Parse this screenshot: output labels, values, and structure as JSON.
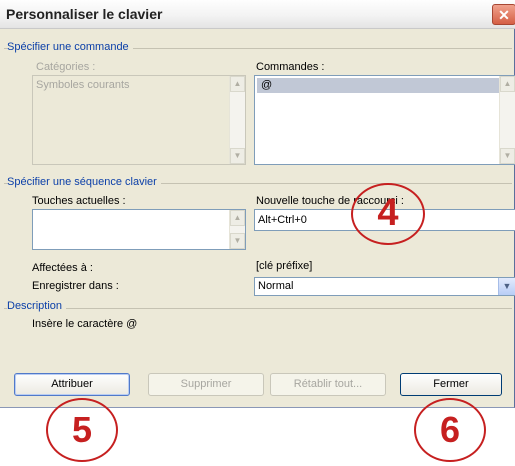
{
  "dialog": {
    "title": "Personnaliser le clavier",
    "close_symbol": "✕"
  },
  "specify_command": {
    "group_label": "Spécifier une commande",
    "categories_label": "Catégories :",
    "categories_items": [
      "Symboles courants"
    ],
    "commands_label": "Commandes :",
    "commands_items": [
      "@"
    ]
  },
  "specify_sequence": {
    "group_label": "Spécifier une séquence clavier",
    "current_keys_label": "Touches actuelles :",
    "current_keys_items": [],
    "new_shortcut_label": "Nouvelle touche de raccourci :",
    "new_shortcut_value": "Alt+Ctrl+0",
    "assigned_to_label": "Affectées à :",
    "assigned_to_value": "[clé préfixe]",
    "save_in_label": "Enregistrer dans :",
    "save_in_value": "Normal"
  },
  "description": {
    "group_label": "Description",
    "text": "Insère le caractère @"
  },
  "buttons": {
    "assign": "Attribuer",
    "remove": "Supprimer",
    "reset_all": "Rétablir tout...",
    "close": "Fermer"
  },
  "callouts": {
    "four": "4",
    "five": "5",
    "six": "6"
  },
  "colors": {
    "callout": "#c62020",
    "group_label": "#0b3fa8"
  }
}
